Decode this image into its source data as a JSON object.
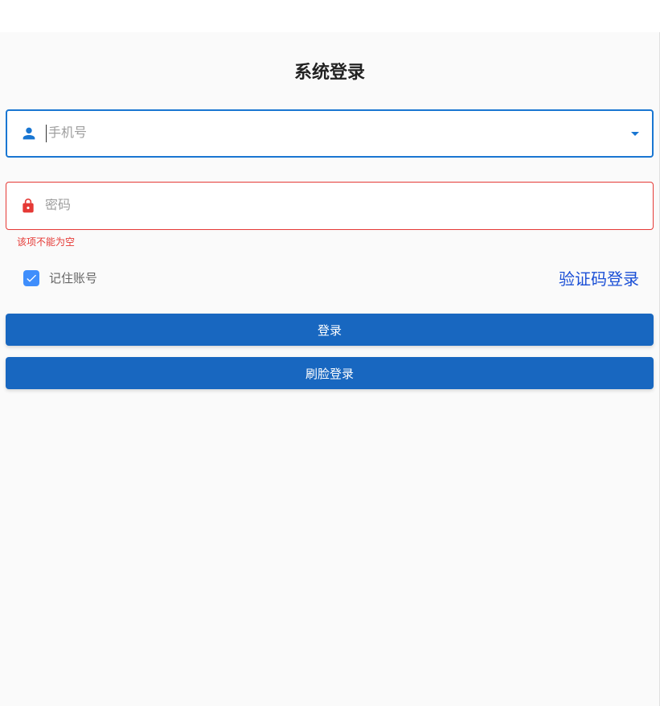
{
  "title": "系统登录",
  "phone": {
    "placeholder": "手机号",
    "value": ""
  },
  "password": {
    "placeholder": "密码",
    "value": "",
    "error": "该项不能为空"
  },
  "remember": {
    "label": "记住账号",
    "checked": true
  },
  "code_login_link": "验证码登录",
  "login_btn": "登录",
  "face_login_btn": "刷脸登录"
}
